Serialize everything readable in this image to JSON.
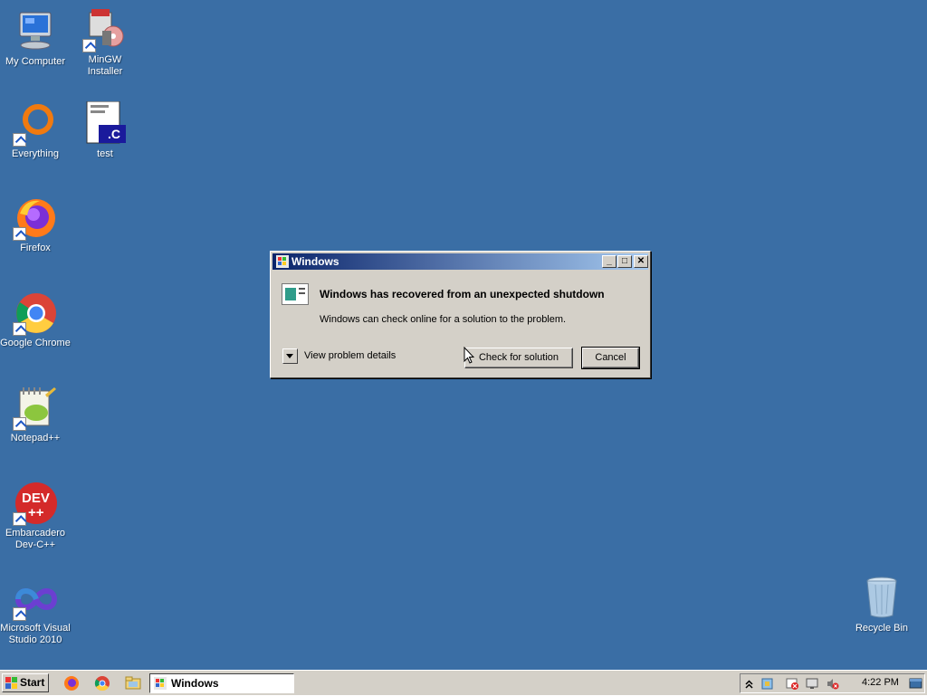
{
  "desktop_icons": [
    {
      "label": "My Computer",
      "icon": "my-computer-icon"
    },
    {
      "label": "MinGW Installer",
      "icon": "installer-icon"
    },
    {
      "label": "Everything",
      "icon": "everything-icon"
    },
    {
      "label": "test",
      "icon": "c-file-icon"
    },
    {
      "label": "Firefox",
      "icon": "firefox-icon"
    },
    {
      "label": "Google Chrome",
      "icon": "chrome-icon"
    },
    {
      "label": "Notepad++",
      "icon": "notepadpp-icon"
    },
    {
      "label": "Embarcadero Dev-C++",
      "icon": "devcpp-icon"
    },
    {
      "label": "Microsoft Visual Studio 2010",
      "icon": "visual-studio-icon"
    },
    {
      "label": "Recycle Bin",
      "icon": "recycle-bin-icon"
    }
  ],
  "dialog": {
    "title": "Windows",
    "heading": "Windows has recovered from an unexpected shutdown",
    "message": "Windows can check online for a solution to the problem.",
    "details_label": "View problem details",
    "check_button": "Check for solution",
    "cancel_button": "Cancel",
    "minimize": "_",
    "maximize": "□",
    "close": "✕"
  },
  "taskbar": {
    "start_label": "Start",
    "window_button": "Windows",
    "clock": "4:22 PM"
  },
  "colors": {
    "desktop": "#3a6ea5",
    "titlebar_start": "#0a246a",
    "titlebar_end": "#a6caf0",
    "chrome": "#d4d0c8"
  }
}
